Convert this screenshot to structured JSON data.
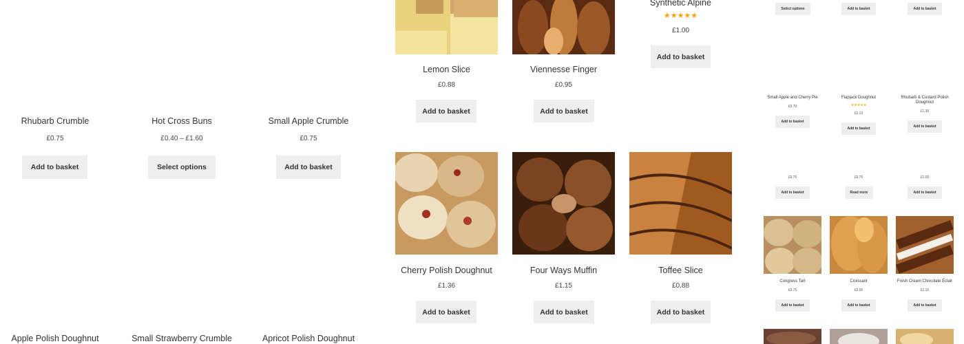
{
  "colors": {
    "button_bg": "#eeeeee",
    "star": "#f0a500"
  },
  "left": [
    {
      "title": "Rhubarb Crumble",
      "price": "£0.75",
      "button": "Add to basket"
    },
    {
      "title": "Hot Cross Buns",
      "price": "£0.40 – £1.60",
      "button": "Select options"
    },
    {
      "title": "Small Apple Crumble",
      "price": "£0.75",
      "button": "Add to basket"
    },
    {
      "title": "Apple Polish Doughnut"
    },
    {
      "title": "Small Strawberry Crumble"
    },
    {
      "title": "Apricot Polish Doughnut"
    }
  ],
  "middle": [
    {
      "title": "Lemon Slice",
      "price": "£0.88",
      "button": "Add to basket",
      "image": "lemon-slice-image"
    },
    {
      "title": "Viennesse Finger",
      "price": "£0.95",
      "button": "Add to basket",
      "image": "viennesse-finger-image"
    },
    {
      "title": "Synthetic Alpine",
      "rating": "★★★★★",
      "price": "£1.00",
      "button": "Add to basket"
    },
    {
      "title": "Cherry Polish Doughnut",
      "price": "£1.36",
      "button": "Add to basket",
      "image": "cherry-polish-doughnut-image"
    },
    {
      "title": "Four Ways Muffin",
      "price": "£1.15",
      "button": "Add to basket",
      "image": "four-ways-muffin-image"
    },
    {
      "title": "Toffee Slice",
      "price": "£0.88",
      "button": "Add to basket",
      "image": "toffee-slice-image"
    }
  ],
  "right": {
    "top_buttons": [
      "Select options",
      "Add to basket",
      "Add to basket"
    ],
    "row1": [
      {
        "title": "Small Apple and Cherry Pie",
        "price": "£0.70",
        "button": "Add to basket"
      },
      {
        "title": "Flapjack Doughnut",
        "rating": "★★★★★",
        "price": "£1.12",
        "button": "Add to basket"
      },
      {
        "title": "Rhubarb & Custard Polish Doughnut",
        "price": "£1.36",
        "button": "Add to basket"
      }
    ],
    "row2": [
      {
        "price": "£0.70",
        "button": "Add to basket"
      },
      {
        "price": "£0.70",
        "button": "Read more"
      },
      {
        "price": "£1.00",
        "button": "Add to basket"
      }
    ],
    "row3": [
      {
        "title": "Congress Tart",
        "price": "£0.75",
        "button": "Add to basket"
      },
      {
        "title": "Croissant",
        "price": "£0.90",
        "button": "Add to basket"
      },
      {
        "title": "Fresh Cream Chocolate Éclair",
        "price": "£1.15",
        "button": "Add to basket"
      }
    ]
  }
}
